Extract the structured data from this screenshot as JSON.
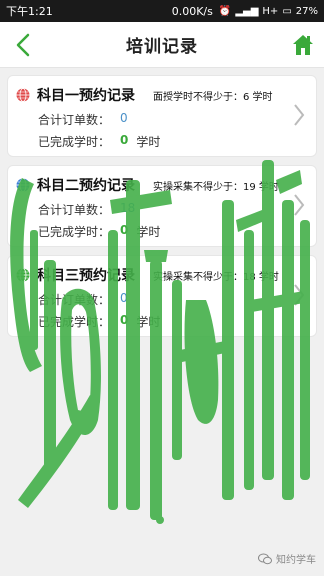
{
  "status_bar": {
    "time": "下午1:21",
    "network_speed": "0.00K/s",
    "signal": "H+",
    "battery": "27%"
  },
  "header": {
    "title": "培训记录"
  },
  "records": [
    {
      "title": "科目一预约记录",
      "requirement": "面授学时不得少于：6 学时",
      "order_label": "合计订单数：",
      "order_count": "0",
      "hours_label": "已完成学时：",
      "hours_done": "0",
      "hours_unit": "学时",
      "globe_color": "#e04a4a"
    },
    {
      "title": "科目二预约记录",
      "requirement": "实操采集不得少于：19 学时",
      "order_label": "合计订单数：",
      "order_count": "18",
      "hours_label": "已完成学时：",
      "hours_done": "0",
      "hours_unit": "学时",
      "globe_color": "#3a7fd5"
    },
    {
      "title": "科目三预约记录",
      "requirement": "实操采集不得少于：18 学时",
      "order_label": "合计订单数：",
      "order_count": "0",
      "hours_label": "已完成学时：",
      "hours_done": "0",
      "hours_unit": "学时",
      "globe_color": "#3aa93a"
    }
  ],
  "footer": {
    "brand": "知约学车"
  },
  "colors": {
    "accent": "#3aa93a",
    "watermark": "#44b04a"
  }
}
